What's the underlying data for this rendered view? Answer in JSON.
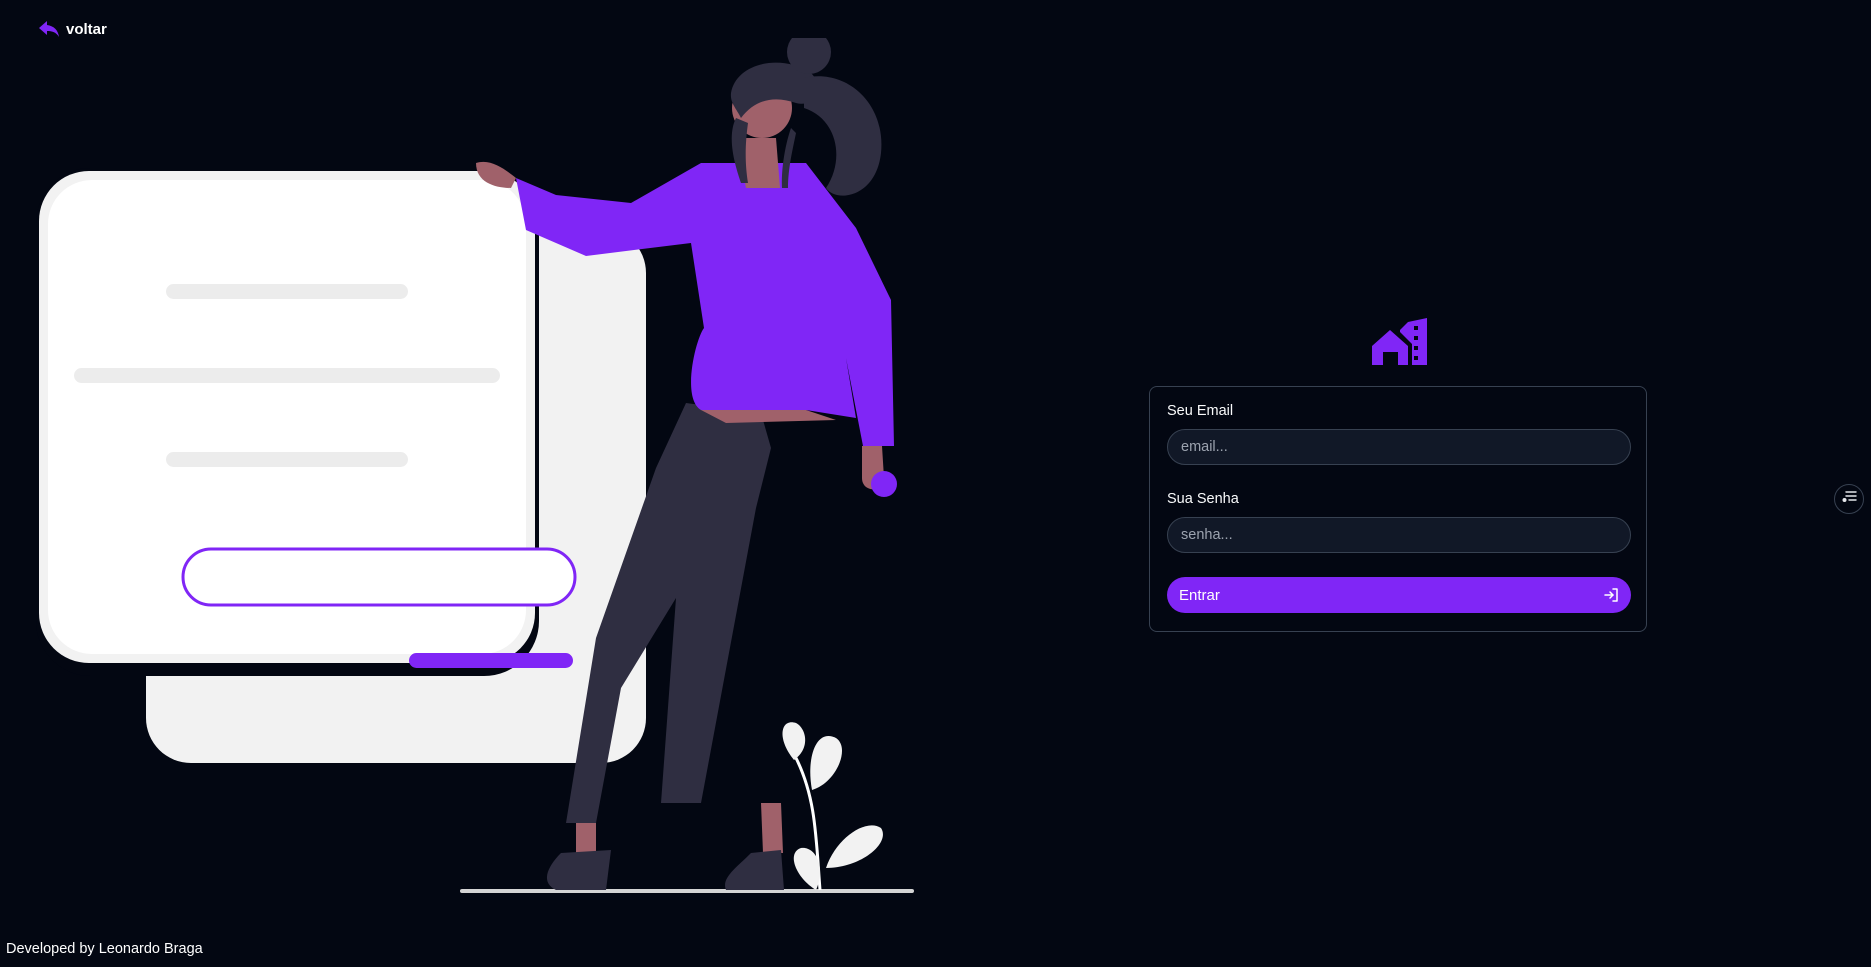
{
  "header": {
    "back_label": "voltar"
  },
  "login": {
    "email_label": "Seu Email",
    "email_placeholder": "email...",
    "email_value": "",
    "password_label": "Sua Senha",
    "password_placeholder": "senha...",
    "password_value": "",
    "submit_label": "Entrar"
  },
  "footer": {
    "credit": "Developed by Leonardo Braga"
  },
  "icons": {
    "back": "reply-arrow-icon",
    "logo": "house-building-logo-icon",
    "submit": "login-arrow-icon",
    "side_toggle": "settings-list-icon"
  },
  "colors": {
    "background": "#030712",
    "accent": "#8026f6",
    "card_border": "#374151",
    "input_background": "#111827"
  }
}
